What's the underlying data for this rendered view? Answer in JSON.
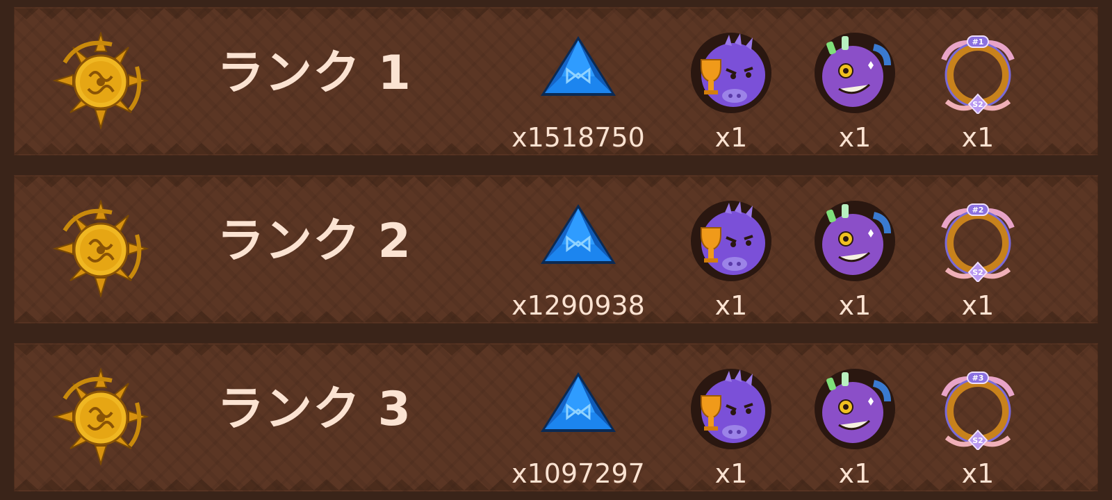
{
  "ranks": [
    {
      "title": "ランク 1",
      "frame_badge": "#1",
      "frame_season": "S2",
      "rewards": {
        "gem_qty": "x1518750",
        "axie_trophy_qty": "x1",
        "axie_grin_qty": "x1",
        "frame_qty": "x1"
      }
    },
    {
      "title": "ランク 2",
      "frame_badge": "#2",
      "frame_season": "S2",
      "rewards": {
        "gem_qty": "x1290938",
        "axie_trophy_qty": "x1",
        "axie_grin_qty": "x1",
        "frame_qty": "x1"
      }
    },
    {
      "title": "ランク 3",
      "frame_badge": "#3",
      "frame_season": "S2",
      "rewards": {
        "gem_qty": "x1097297",
        "axie_trophy_qty": "x1",
        "axie_grin_qty": "x1",
        "frame_qty": "x1"
      }
    }
  ],
  "icons": {
    "emblem": "golden-sun-emblem-icon",
    "gem": "blue-crystal-gem-icon",
    "axie_trophy": "purple-axie-trophy-icon",
    "axie_grin": "purple-axie-grin-icon",
    "frame": "rank-frame-icon"
  },
  "colors": {
    "row_bg": "#5b3624",
    "page_bg": "#3a2419",
    "text": "#fbe3d2",
    "gold": "#e6a614",
    "gem_blue": "#1a78e6",
    "axie_purple": "#7b50d8"
  }
}
